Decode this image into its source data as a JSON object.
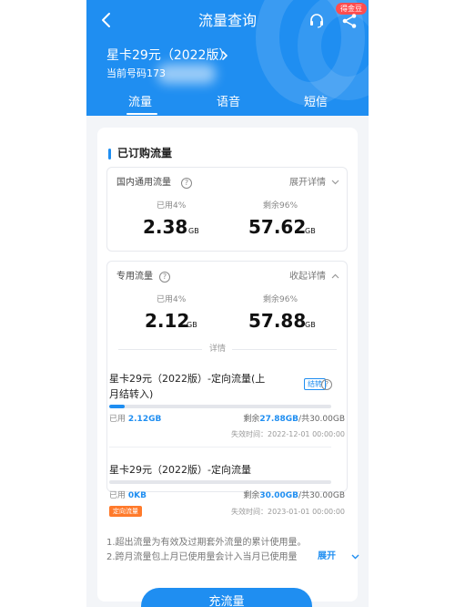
{
  "header": {
    "title": "流量查询",
    "badge": "得金豆",
    "plan_name": "星卡29元（2022版）",
    "phone_label": "当前号码173",
    "back_icon": "chevron-left-icon",
    "service_icon": "headset-icon",
    "share_icon": "share-icon"
  },
  "tabs": [
    {
      "label": "流量",
      "active": true
    },
    {
      "label": "语音",
      "active": false
    },
    {
      "label": "短信",
      "active": false
    }
  ],
  "section_title": "已订购流量",
  "general": {
    "name": "国内通用流量",
    "toggle": "展开详情",
    "used_label": "已用4%",
    "used_value": "2.38",
    "used_unit": "GB",
    "remain_label": "剩余96%",
    "remain_value": "57.62",
    "remain_unit": "GB"
  },
  "special": {
    "name": "专用流量",
    "toggle": "收起详情",
    "used_label": "已用4%",
    "used_value": "2.12",
    "used_unit": "GB",
    "remain_label": "剩余96%",
    "remain_value": "57.88",
    "remain_unit": "GB",
    "detail_label": "详情",
    "items": [
      {
        "name_line1": "星卡29元（2022版）-定向流量(上",
        "name_line2": "月结转入)",
        "tag": "结转",
        "used_prefix": "已用 ",
        "used": "2.12GB",
        "remain_prefix": "剩余",
        "remain": "27.88GB",
        "total": "/共30.00GB",
        "expire": "失效时间：2022-12-01 00:00:00",
        "used_fraction": 0.0707
      },
      {
        "name_line1": "星卡29元（2022版）-定向流量",
        "tag": "定向流量",
        "used_prefix": "已用 ",
        "used": "0KB",
        "remain_prefix": "剩余",
        "remain": "30.00GB",
        "total": "/共30.00GB",
        "expire": "失效时间：2023-01-01 00:00:00",
        "used_fraction": 0
      }
    ]
  },
  "notes": {
    "line1": "1.超出流量为有效及过期套外流量的累计使用量。",
    "line2": "2.跨月流量包上月已使用量会计入当月已使用量",
    "expand": "展开"
  },
  "recharge_button": "充流量",
  "colors": {
    "primary": "#1f8ef1",
    "orange": "#ff7a2b",
    "badge": "#ff4d4f"
  }
}
